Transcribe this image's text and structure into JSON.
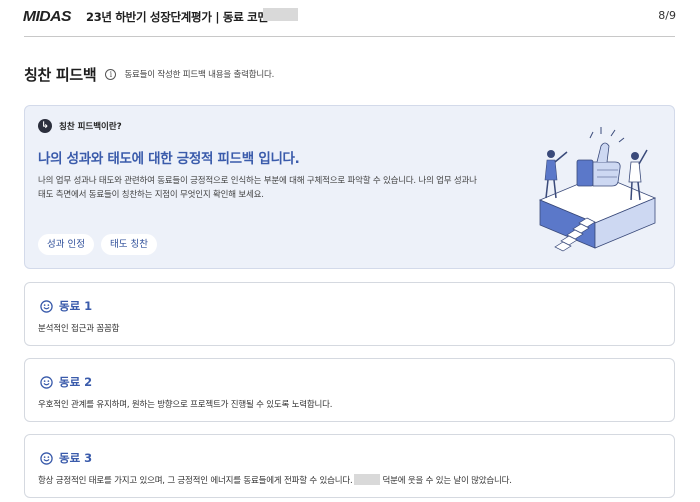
{
  "header": {
    "logo": "MIDAS",
    "title": "23년 하반기 성장단계평가 | 동료 코멘트",
    "page": "8/9"
  },
  "section": {
    "title": "칭찬 피드백",
    "info_icon": "info-icon",
    "description": "동료들이 작성한 피드백 내용을 출력합니다."
  },
  "intro": {
    "question": "칭찬 피드백이란?",
    "heading": "나의 성과와 태도에 대한 긍정적 피드백 입니다.",
    "body": "나의 업무 성과나 태도와 관련하여 동료들이 긍정적으로 인식하는 부분에 대해 구체적으로 파악할 수 있습니다. 나의 업무 성과나 태도 측면에서 동료들이 칭찬하는 지점이 무엇인지 확인해 보세요.",
    "tags": [
      "성과 인정",
      "태도 칭찬"
    ]
  },
  "peers": [
    {
      "name": "동료 1",
      "comment": "분석적인 접근과 꼼꼼함"
    },
    {
      "name": "동료 2",
      "comment": "우호적인 관계를 유지하며, 원하는 방향으로 프로젝트가 진행될 수 있도록 노력합니다."
    },
    {
      "name": "동료 3",
      "comment_before": "항상 긍정적인 태로를 가지고 있으며, 그 긍정적인 에너지를 동료들에게 전파할 수 있습니다.",
      "comment_after": "덕분에 웃을 수 있는 날이 많았습니다."
    }
  ],
  "colors": {
    "accent": "#3a5bab",
    "intro_bg": "#edf1f9",
    "redaction": "#d9d9d9"
  }
}
